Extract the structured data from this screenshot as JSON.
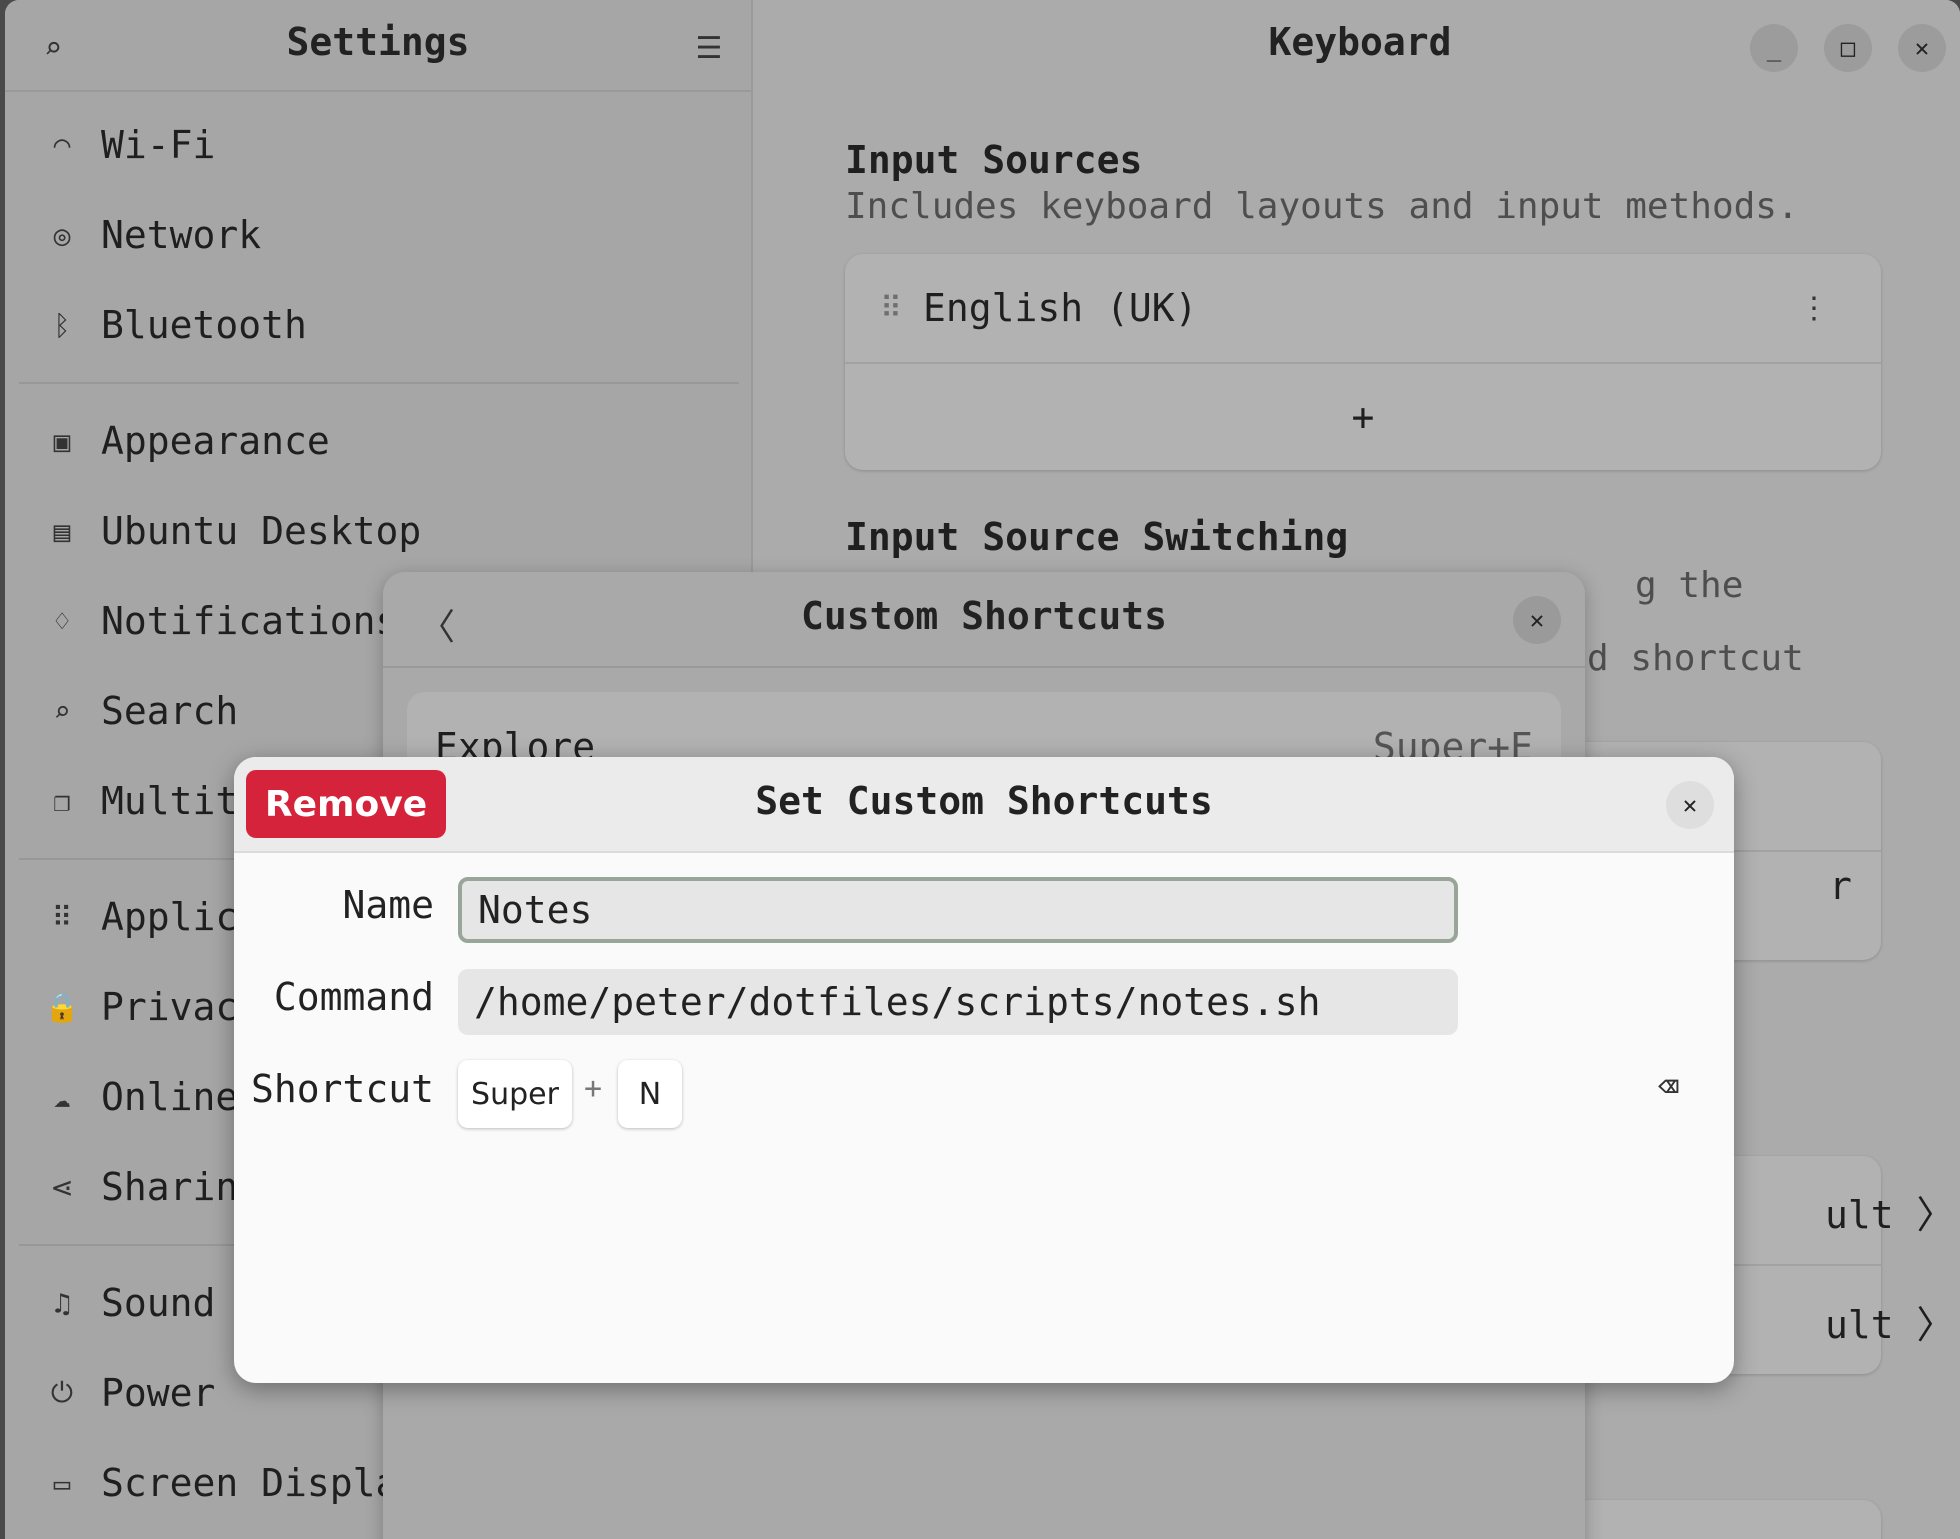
{
  "sidebar": {
    "title": "Settings",
    "items": [
      {
        "label": "Wi-Fi",
        "icon": "wifi-icon",
        "glyph": "◠"
      },
      {
        "label": "Network",
        "icon": "network-icon",
        "glyph": "◎"
      },
      {
        "label": "Bluetooth",
        "icon": "bluetooth-icon",
        "glyph": "ᛒ"
      },
      {
        "label": "Appearance",
        "icon": "appearance-icon",
        "glyph": "▣"
      },
      {
        "label": "Ubuntu Desktop",
        "icon": "ubuntu-desktop-icon",
        "glyph": "▤"
      },
      {
        "label": "Notifications",
        "icon": "bell-icon",
        "glyph": "♢"
      },
      {
        "label": "Search",
        "icon": "search-icon",
        "glyph": "⌕"
      },
      {
        "label": "Multit",
        "icon": "multitasking-icon",
        "glyph": "❐"
      },
      {
        "label": "Applic",
        "icon": "apps-icon",
        "glyph": "⠿"
      },
      {
        "label": "Privac",
        "icon": "lock-icon",
        "glyph": "🔒"
      },
      {
        "label": "Online",
        "icon": "cloud-icon",
        "glyph": "☁"
      },
      {
        "label": "Sharin",
        "icon": "share-icon",
        "glyph": "⋖"
      },
      {
        "label": "Sound",
        "icon": "music-icon",
        "glyph": "♫"
      },
      {
        "label": "Power",
        "icon": "power-icon",
        "glyph": "⏻"
      },
      {
        "label": "Screen Displa",
        "icon": "display-icon",
        "glyph": "▭"
      }
    ]
  },
  "main": {
    "title": "Keyboard",
    "input_sources": {
      "title": "Input Sources",
      "subtitle": "Includes keyboard layouts and input methods.",
      "layout": "English (UK)",
      "add": "+"
    },
    "switching": {
      "title": "Input Source Switching",
      "partial1": "g the",
      "partial2": "d shortcut",
      "partial3": "r",
      "partial4": "ult",
      "partial5": "ult"
    }
  },
  "custom_shortcuts": {
    "title": "Custom Shortcuts",
    "row_name": "Explore",
    "row_accel": "Super+E"
  },
  "set_dialog": {
    "title": "Set Custom Shortcuts",
    "remove": "Remove",
    "name_label": "Name",
    "name_value": "Notes",
    "command_label": "Command",
    "command_value": "/home/peter/dotfiles/scripts/notes.sh",
    "shortcut_label": "Shortcut",
    "keys": [
      "Super",
      "N"
    ],
    "plus": "+"
  },
  "colors": {
    "destructive": "#d6233c"
  }
}
